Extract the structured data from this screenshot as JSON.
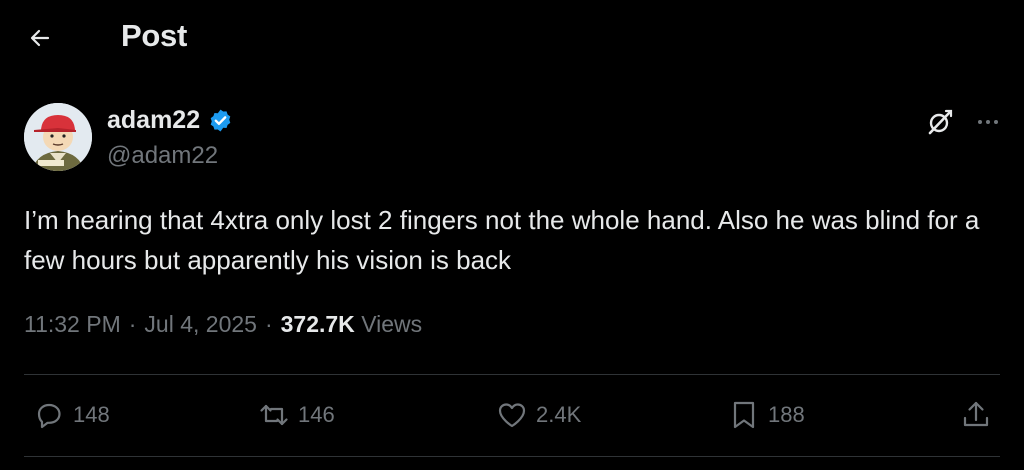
{
  "header": {
    "title": "Post",
    "back_icon": "arrow-left-icon"
  },
  "author": {
    "display_name": "adam22",
    "handle": "@adam22",
    "verified": true,
    "verified_color": "#1d9bf0"
  },
  "post": {
    "text": "I’m hearing that 4xtra only lost 2 fingers not the whole hand. Also he was blind for a few hours but apparently his vision is back",
    "time": "11:32 PM",
    "date": "Jul 4, 2025",
    "separator": "·",
    "views_count": "372.7K",
    "views_label": "Views"
  },
  "actions": {
    "replies": "148",
    "reposts": "146",
    "likes": "2.4K",
    "bookmarks": "188"
  },
  "colors": {
    "background": "#000000",
    "text_primary": "#e7e9ea",
    "text_secondary": "#71767b",
    "divider": "#2f3336"
  }
}
